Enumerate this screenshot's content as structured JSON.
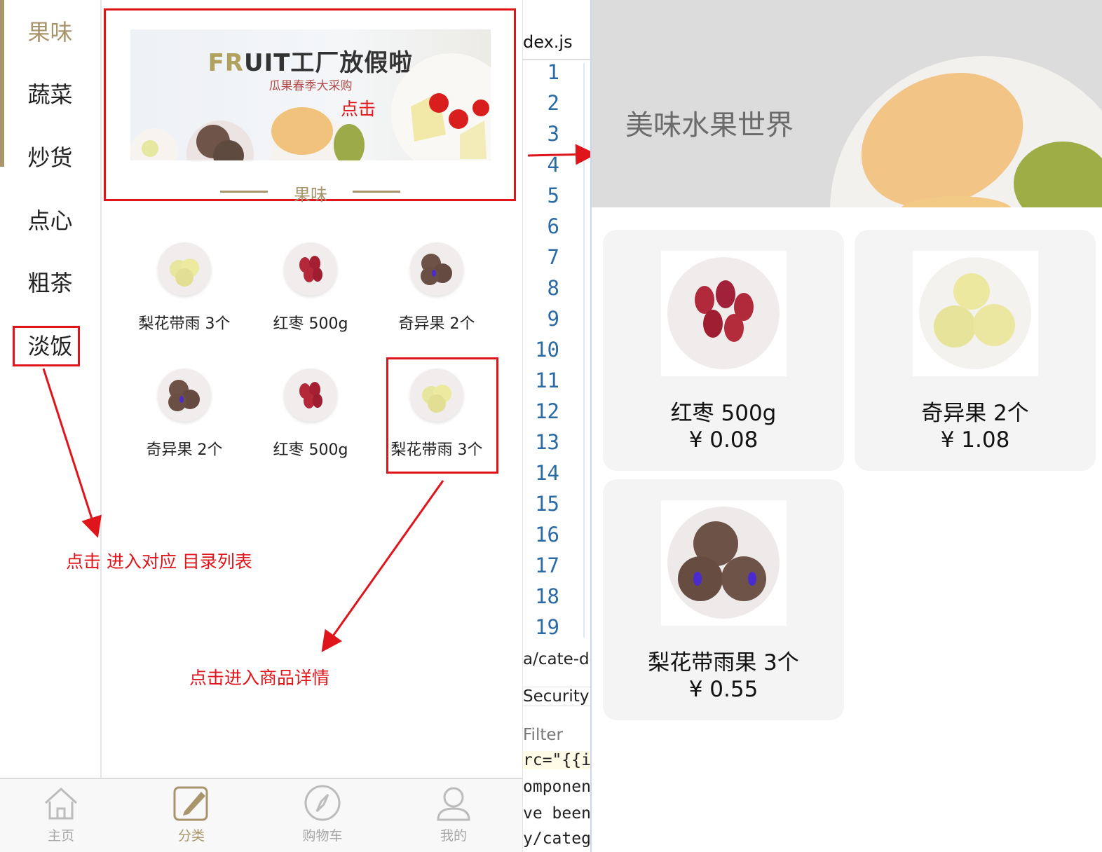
{
  "left_app": {
    "categories": [
      "果味",
      "蔬菜",
      "炒货",
      "点心",
      "粗茶",
      "淡饭"
    ],
    "banner": {
      "title_prefix": "FR",
      "title_rest": "UIT工厂放假啦",
      "subtitle": "瓜果春季大采购"
    },
    "section_title": "果味",
    "products": [
      {
        "name": "梨花带雨 3个",
        "icon": "pear-plate-icon"
      },
      {
        "name": "红枣 500g",
        "icon": "jujube-plate-icon"
      },
      {
        "name": "奇异果 2个",
        "icon": "kiwi-plate-icon"
      },
      {
        "name": "奇异果 2个",
        "icon": "kiwi-plate-icon"
      },
      {
        "name": "红枣 500g",
        "icon": "jujube-plate-icon"
      },
      {
        "name": "梨花带雨 3个",
        "icon": "pear-plate-icon"
      }
    ],
    "tabs": [
      {
        "label": "主页",
        "icon": "home-icon"
      },
      {
        "label": "分类",
        "icon": "category-edit-icon"
      },
      {
        "label": "购物车",
        "icon": "compass-icon"
      },
      {
        "label": "我的",
        "icon": "user-icon"
      }
    ],
    "accent_color": "#a8956b"
  },
  "annotations": {
    "banner_click": "点击",
    "category_click": "点击 进入对应 目录列表",
    "product_click": "点击进入商品详情",
    "highlight_color": "#e0141b"
  },
  "editor": {
    "file_tab": "dex.js",
    "line_numbers": [
      "1",
      "2",
      "3",
      "4",
      "5",
      "6",
      "7",
      "8",
      "9",
      "10",
      "11",
      "12",
      "13",
      "14",
      "15",
      "16",
      "17",
      "18",
      "19"
    ],
    "path_fragment": "a/cate-de",
    "security_tab": "Security",
    "filter_label": "Filter",
    "code_fragments": [
      "rc=\"{{it",
      "omponent",
      "ve been",
      "y/category"
    ]
  },
  "right_app": {
    "hero_title": "美味水果世界",
    "cards": [
      {
        "name": "红枣 500g",
        "price": "¥ 0.08",
        "icon": "jujube-plate-icon"
      },
      {
        "name": "奇异果 2个",
        "price": "¥ 1.08",
        "icon": "pear-plate-icon"
      },
      {
        "name": "梨花带雨果 3个",
        "price": "¥ 0.55",
        "icon": "kiwi-plate-icon"
      }
    ]
  }
}
